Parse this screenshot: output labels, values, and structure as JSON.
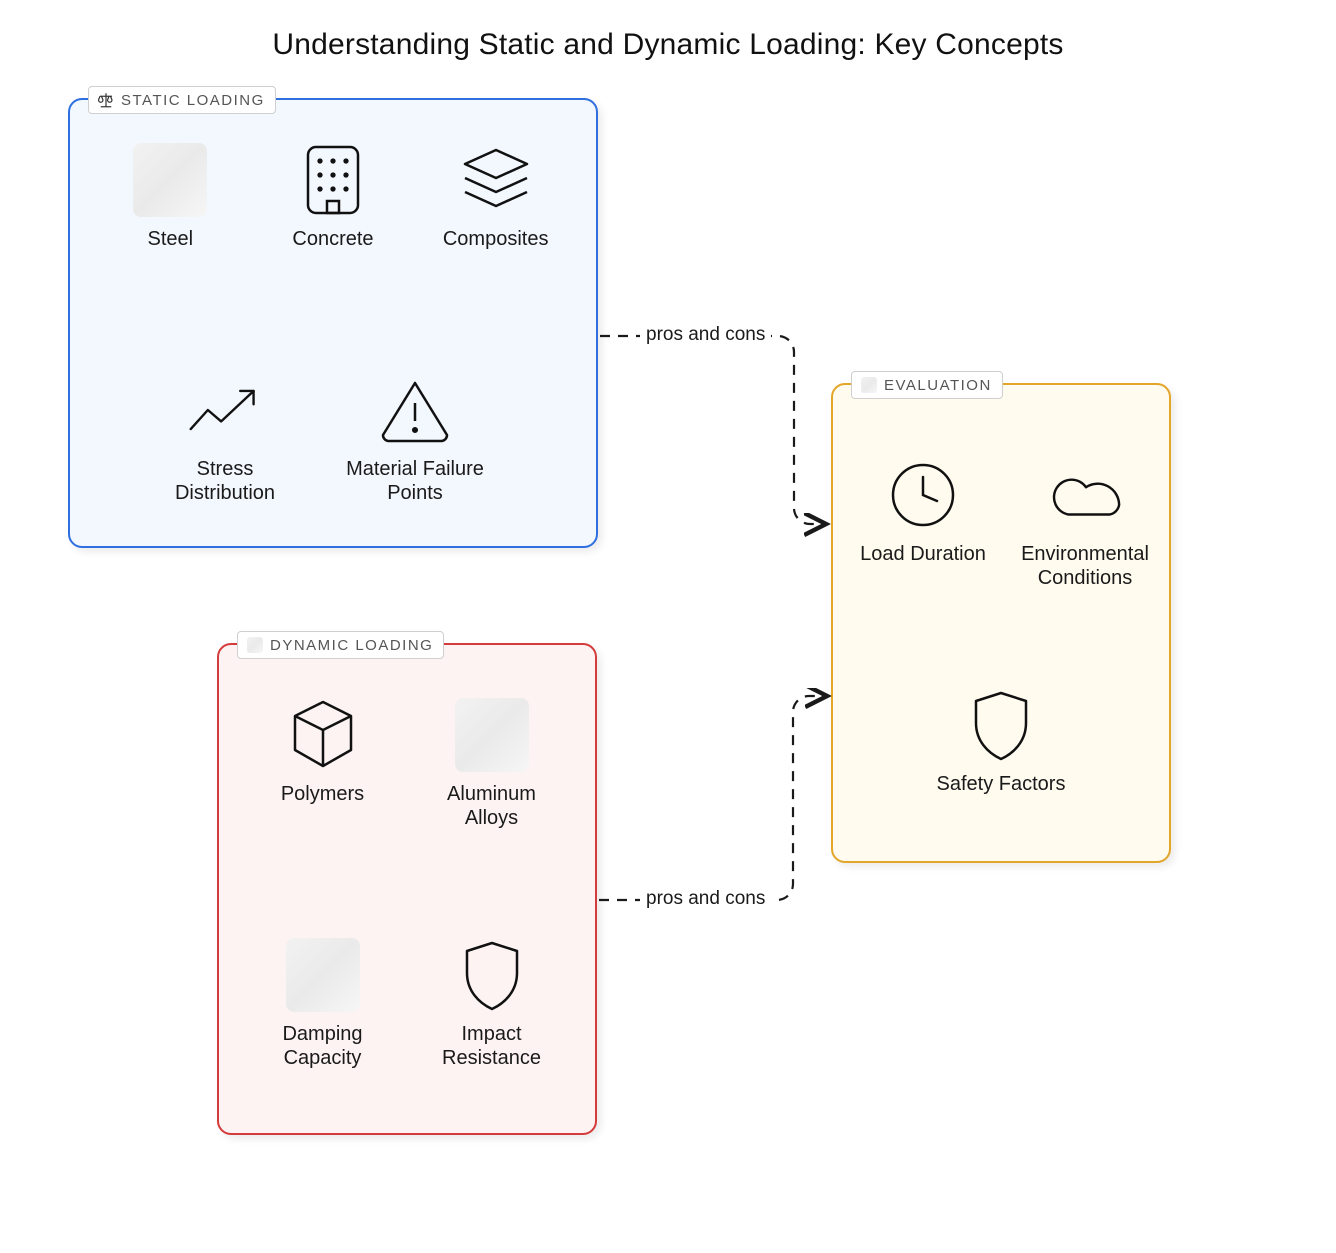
{
  "title": "Understanding Static and Dynamic Loading: Key Concepts",
  "panels": {
    "static": {
      "label": "STATIC LOADING",
      "items": {
        "steel": "Steel",
        "concrete": "Concrete",
        "composites": "Composites",
        "stress": "Stress Distribution",
        "failure": "Material Failure Points"
      }
    },
    "dynamic": {
      "label": "DYNAMIC LOADING",
      "items": {
        "polymers": "Polymers",
        "aluminum": "Aluminum Alloys",
        "damping": "Damping Capacity",
        "impact": "Impact Resistance"
      }
    },
    "evaluation": {
      "label": "EVALUATION",
      "items": {
        "duration": "Load Duration",
        "environment": "Environmental Conditions",
        "safety": "Safety Factors"
      }
    }
  },
  "arrows": {
    "top_label": "pros and cons",
    "bottom_label": "pros and cons"
  }
}
